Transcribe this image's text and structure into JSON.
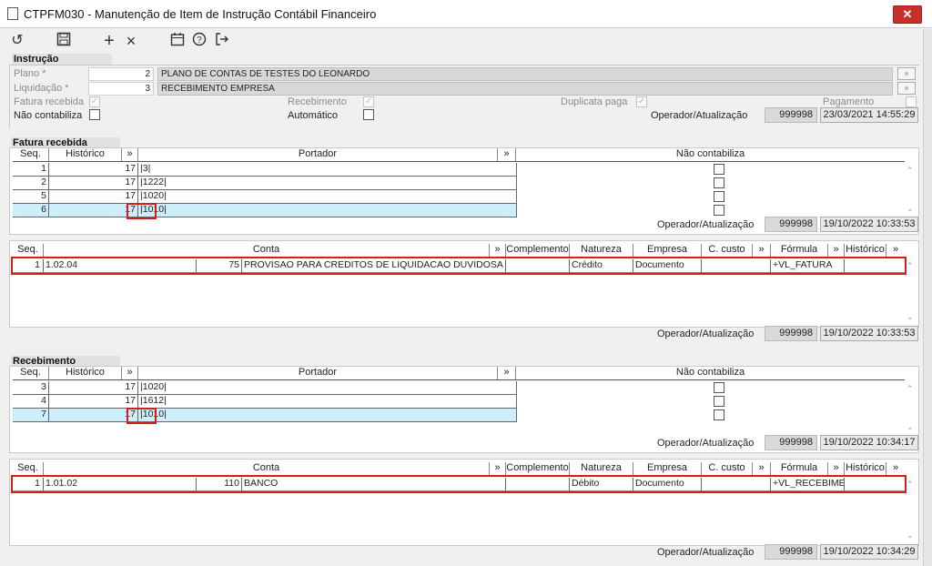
{
  "window": {
    "title": "CTPFM030 - Manutenção de Item de Instrução Contábil Financeiro"
  },
  "toolbar": {
    "icons": [
      "undo-icon",
      "save-icon",
      "add-icon",
      "close-icon",
      "calendar-icon",
      "help-icon",
      "exit-icon"
    ]
  },
  "instrucao": {
    "header": "Instrução",
    "plano_label": "Plano *",
    "plano_code": "2",
    "plano_desc": "PLANO DE CONTAS DE TESTES DO LEONARDO",
    "liquidacao_label": "Liquidação *",
    "liquidacao_code": "3",
    "liquidacao_desc": "RECEBIMENTO EMPRESA",
    "fatura_recebida_label": "Fatura recebida",
    "recebimento_label": "Recebimento",
    "duplicata_paga_label": "Duplicata paga",
    "pagamento_label": "Pagamento",
    "nao_contabiliza_label": "Não contabiliza",
    "automatico_label": "Automático",
    "operador_label": "Operador/Atualização",
    "operador": "999998",
    "atualizacao": "23/03/2021 14:55:29"
  },
  "fatura": {
    "header": "Fatura recebida",
    "cols": {
      "seq": "Seq.",
      "historico": "Histórico",
      "more": "»",
      "portador": "Portador",
      "nao_contabiliza": "Não contabiliza"
    },
    "rows": [
      {
        "seq": "1",
        "hist": "17",
        "port": "|3|"
      },
      {
        "seq": "2",
        "hist": "17",
        "port": "|1222|"
      },
      {
        "seq": "5",
        "hist": "17",
        "port": "|1020|"
      },
      {
        "seq": "6",
        "hist": "17",
        "port": "|1010|"
      }
    ],
    "operador_label": "Operador/Atualização",
    "operador": "999998",
    "atualizacao": "19/10/2022 10:33:53"
  },
  "fatura_conta": {
    "cols": {
      "seq": "Seq.",
      "conta": "Conta",
      "more": "»",
      "complemento": "Complemento",
      "natureza": "Natureza",
      "empresa": "Empresa",
      "ccusto": "C. custo",
      "formula": "Fórmula",
      "historico": "Histórico"
    },
    "row": {
      "seq": "1",
      "conta": "1.02.04",
      "num": "75",
      "desc": "PROVISAO PARA CREDITOS DE LIQUIDACAO DUVIDOSA",
      "complemento": "",
      "natureza": "Crédito",
      "empresa": "Documento",
      "ccusto": "",
      "formula": "+VL_FATURA",
      "historico": ""
    },
    "operador_label": "Operador/Atualização",
    "operador": "999998",
    "atualizacao": "19/10/2022 10:33:53"
  },
  "recebimento": {
    "header": "Recebimento",
    "cols": {
      "seq": "Seq.",
      "historico": "Histórico",
      "more": "»",
      "portador": "Portador",
      "nao_contabiliza": "Não contabiliza"
    },
    "rows": [
      {
        "seq": "3",
        "hist": "17",
        "port": "|1020|"
      },
      {
        "seq": "4",
        "hist": "17",
        "port": "|1612|"
      },
      {
        "seq": "7",
        "hist": "17",
        "port": "|1010|"
      }
    ],
    "operador_label": "Operador/Atualização",
    "operador": "999998",
    "atualizacao": "19/10/2022 10:34:17"
  },
  "recebimento_conta": {
    "cols": {
      "seq": "Seq.",
      "conta": "Conta",
      "more": "»",
      "complemento": "Complemento",
      "natureza": "Natureza",
      "empresa": "Empresa",
      "ccusto": "C. custo",
      "formula": "Fórmula",
      "historico": "Histórico"
    },
    "row": {
      "seq": "1",
      "conta": "1.01.02",
      "num": "110",
      "desc": "BANCO",
      "complemento": "",
      "natureza": "Débito",
      "empresa": "Documento",
      "ccusto": "",
      "formula": "+VL_RECEBIMEN",
      "historico": ""
    },
    "operador_label": "Operador/Atualização",
    "operador": "999998",
    "atualizacao": "19/10/2022 10:34:29"
  }
}
